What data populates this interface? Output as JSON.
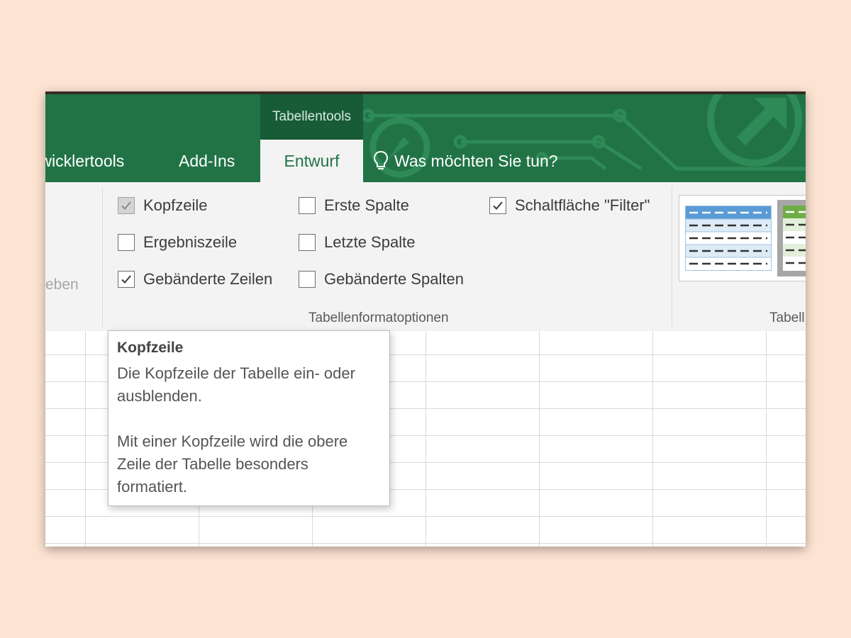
{
  "ribbon_tabs": {
    "entwicklertools": "twicklertools",
    "add_ins": "Add-Ins",
    "entwurf": "Entwurf"
  },
  "context_header": "Tabellentools",
  "tell_me": "Was möchten Sie tun?",
  "left_group_fragment": "eben",
  "options": {
    "kopfzeile": "Kopfzeile",
    "ergebniszeile": "Ergebniszeile",
    "gebaenderte_zeilen": "Gebänderte Zeilen",
    "erste_spalte": "Erste Spalte",
    "letzte_spalte": "Letzte Spalte",
    "gebaenderte_spalten": "Gebänderte Spalten",
    "filter_button": "Schaltfläche \"Filter\""
  },
  "option_states": {
    "kopfzeile": "checked-disabled",
    "ergebniszeile": "unchecked",
    "gebaenderte_zeilen": "checked",
    "erste_spalte": "unchecked",
    "letzte_spalte": "unchecked",
    "gebaenderte_spalten": "unchecked",
    "filter_button": "checked"
  },
  "group_labels": {
    "format_options": "Tabellenformatoptionen",
    "styles_fragment": "Tabell"
  },
  "tooltip": {
    "title": "Kopfzeile",
    "line1": "Die Kopfzeile der Tabelle ein- oder\nausblenden.",
    "line2": "Mit einer Kopfzeile wird die obere\nZeile der Tabelle besonders\nformatiert."
  },
  "colors": {
    "ribbon_green": "#217346",
    "context_green": "#185c37",
    "page_background": "#fde3d2",
    "style_blue": "#5b9bd5",
    "style_green": "#70ad47"
  }
}
